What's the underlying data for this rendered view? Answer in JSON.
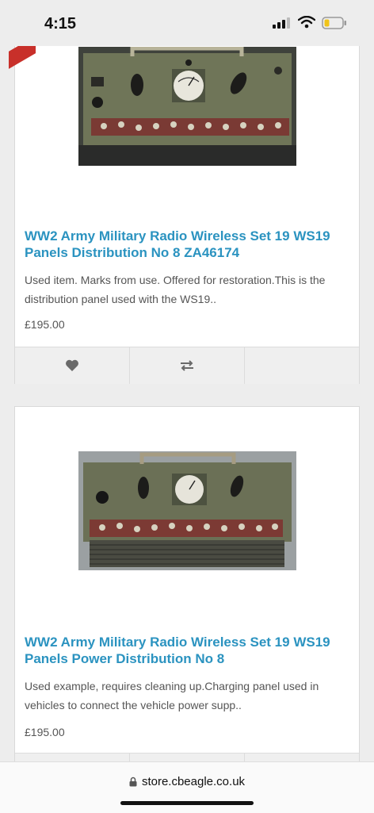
{
  "status_bar": {
    "time": "4:15",
    "icons": [
      "cellular-signal-icon",
      "wifi-icon",
      "battery-icon"
    ]
  },
  "products": [
    {
      "title": "WW2 Army Military Radio Wireless Set 19 WS19 Panels Distribution No 8 ZA46174",
      "description": "Used item. Marks from use. Offered for restoration.This is the distribution panel used with the WS19..",
      "price": "£195.00",
      "image": "radio-distribution-panel-photo",
      "actions": [
        "wishlist-heart-icon",
        "compare-arrows-icon"
      ]
    },
    {
      "title": "WW2 Army Military Radio Wireless Set 19 WS19 Panels Power Distribution No 8",
      "description": "Used example, requires cleaning up.Charging panel used in vehicles to connect the vehicle power supp..",
      "price": "£195.00",
      "image": "radio-power-distribution-panel-photo",
      "actions": [
        "wishlist-heart-icon",
        "compare-arrows-icon"
      ]
    }
  ],
  "browser": {
    "url": "store.cbeagle.co.uk",
    "url_icon": "lock-icon"
  },
  "colors": {
    "title": "#2b93c0",
    "ribbon": "#c8302a",
    "background": "#ededed"
  }
}
